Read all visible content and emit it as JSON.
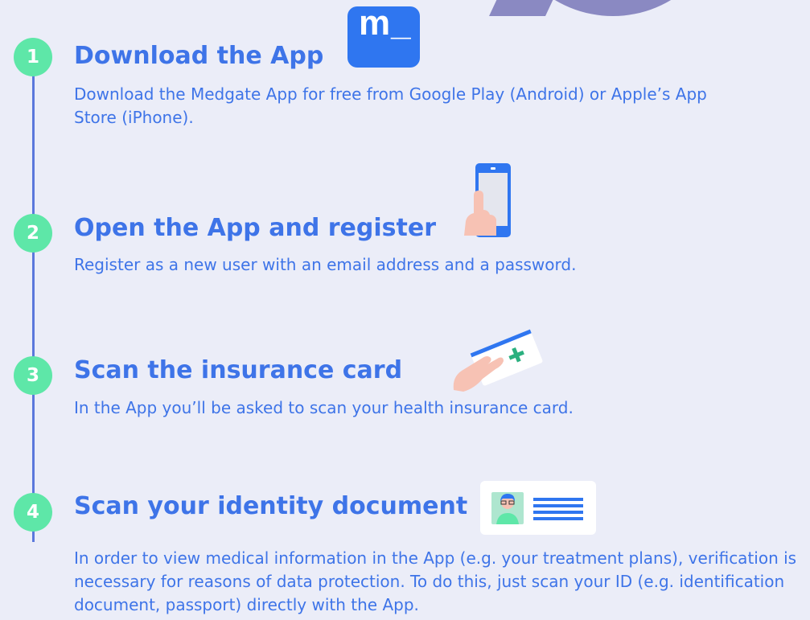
{
  "steps": [
    {
      "num": "1",
      "title": "Download the App",
      "desc": "Download the Medgate App for free from Google Play (Android) or Apple’s App Store (iPhone)."
    },
    {
      "num": "2",
      "title": "Open the App and register",
      "desc": "Register as a new user with an email address and a password."
    },
    {
      "num": "3",
      "title": "Scan the insurance card",
      "desc": "In the App you’ll be asked to scan your health insurance card."
    },
    {
      "num": "4",
      "title": "Scan your identity document",
      "desc": "In order to view medical information in the App (e.g. your treatment plans), verification is necessary for reasons of data protection. To do this, just scan your ID (e.g. identification document, passport) directly with the App."
    }
  ],
  "app_icon_label": "m_",
  "colors": {
    "accent": "#3e74e8",
    "badge": "#5ee7a8",
    "line": "#5b78dc",
    "background": "#ebedf8",
    "bubble": "#8a89c2"
  }
}
